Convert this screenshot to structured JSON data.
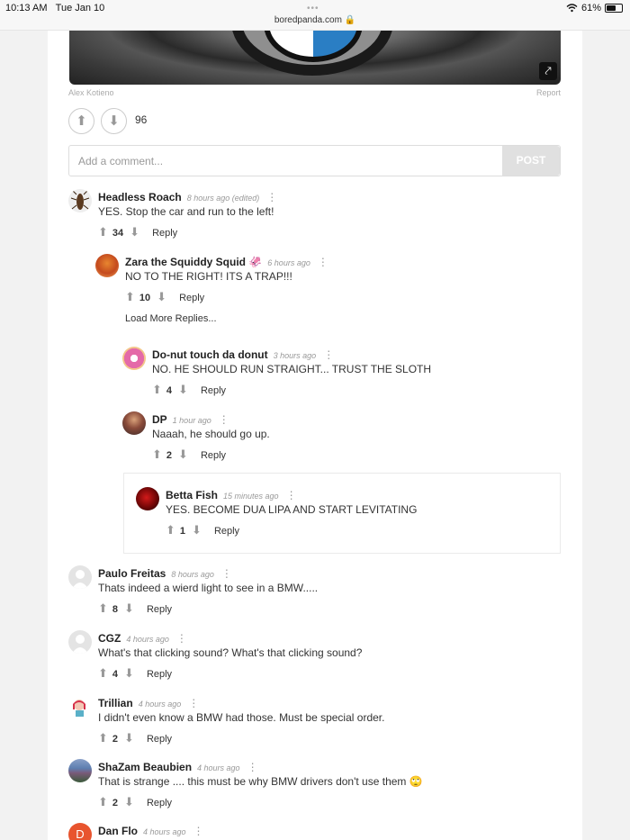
{
  "status_bar": {
    "time": "10:13 AM",
    "date": "Tue Jan 10",
    "url": "boredpanda.com",
    "battery": "61%",
    "battery_level": 0.61
  },
  "post": {
    "credit": "Alex Kotieno",
    "report": "Report",
    "votes": "96"
  },
  "comment_form": {
    "placeholder": "Add a comment...",
    "post_label": "POST"
  },
  "reply_label": "Reply",
  "load_more": "Load More Replies...",
  "comments": [
    {
      "name": "Headless Roach",
      "time": "8 hours ago (edited)",
      "text": "YES. Stop the car and run to the left!",
      "votes": "34"
    },
    {
      "name": "Zara the Squiddy Squid 🦑",
      "time": "6 hours ago",
      "text": "NO TO THE RIGHT! ITS A TRAP!!!",
      "votes": "10"
    },
    {
      "name": "Do-nut touch da donut",
      "time": "3 hours ago",
      "text": "NO. HE SHOULD RUN STRAIGHT... TRUST THE SLOTH",
      "votes": "4"
    },
    {
      "name": "DP",
      "time": "1 hour ago",
      "text": "Naaah, he should go up.",
      "votes": "2"
    },
    {
      "name": "Betta Fish",
      "time": "15 minutes ago",
      "text": "YES. BECOME DUA LIPA AND START LEVITATING",
      "votes": "1"
    },
    {
      "name": "Paulo Freitas",
      "time": "8 hours ago",
      "text": "Thats indeed a wierd light to see in a BMW.....",
      "votes": "8"
    },
    {
      "name": "CGZ",
      "time": "4 hours ago",
      "text": "What's that clicking sound? What's that clicking sound?",
      "votes": "4"
    },
    {
      "name": "Trillian",
      "time": "4 hours ago",
      "text": "I didn't even know a BMW had those. Must be special order.",
      "votes": "2"
    },
    {
      "name": "ShaZam Beaubien",
      "time": "4 hours ago",
      "text": "That is strange .... this must be why BMW drivers don't use them 🙄",
      "votes": "2"
    },
    {
      "name": "Dan Flo",
      "time": "4 hours ago",
      "text": "",
      "votes": "",
      "initial": "D"
    }
  ]
}
